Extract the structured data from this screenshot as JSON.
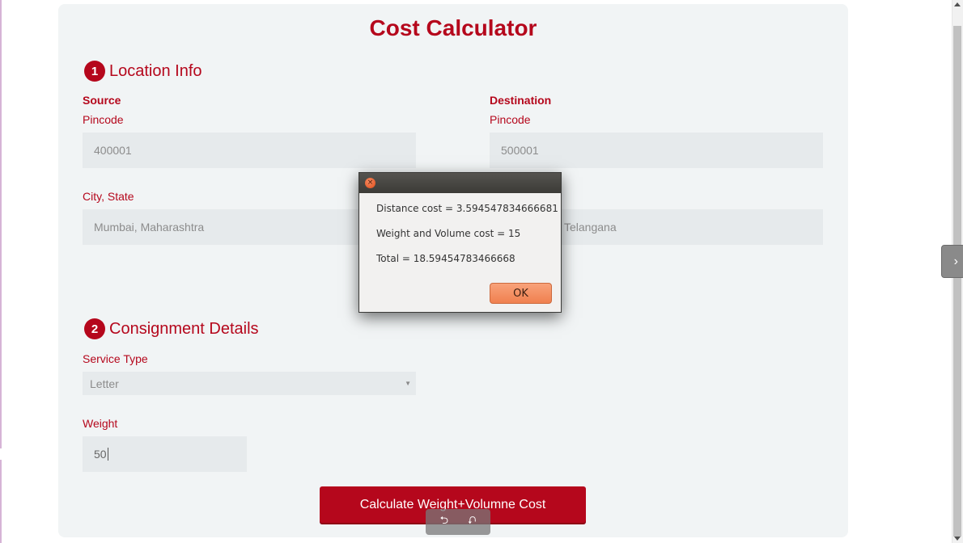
{
  "page": {
    "title": "Cost Calculator"
  },
  "location": {
    "step": "1",
    "heading": "Location Info",
    "source": {
      "title": "Source",
      "pincode_label": "Pincode",
      "pincode_value": "400001",
      "city_label": "City, State",
      "city_value": "Mumbai, Maharashtra"
    },
    "destination": {
      "title": "Destination",
      "pincode_label": "Pincode",
      "pincode_value": "500001",
      "city_value_visible": "Telangana"
    }
  },
  "consignment": {
    "step": "2",
    "heading": "Consignment Details",
    "service_label": "Service Type",
    "service_value": "Letter",
    "weight_label": "Weight",
    "weight_value": "50"
  },
  "actions": {
    "calculate_label": "Calculate Weight+Volumne Cost"
  },
  "dialog": {
    "close_glyph": "×",
    "line1": "Distance cost = 3.594547834666681",
    "line2": "Weight and Volume cost = 15",
    "line3": "Total = 18.59454783466668",
    "ok_label": "OK"
  },
  "overlay": {
    "left_glyph": "⮌",
    "right_glyph": "⮏",
    "side_tab_glyph": "›"
  },
  "colors": {
    "accent": "#b5071c",
    "panel_bg": "#f1f4f5",
    "field_bg": "#e6eaec",
    "dialog_bar": "#3c3b37",
    "ok_button": "#f0804f"
  },
  "icons": {
    "step_badges": "numbered-circle",
    "dialog_close": "close-icon",
    "select_caret": "caret-down-icon",
    "side_tab": "chevron-right-icon"
  }
}
